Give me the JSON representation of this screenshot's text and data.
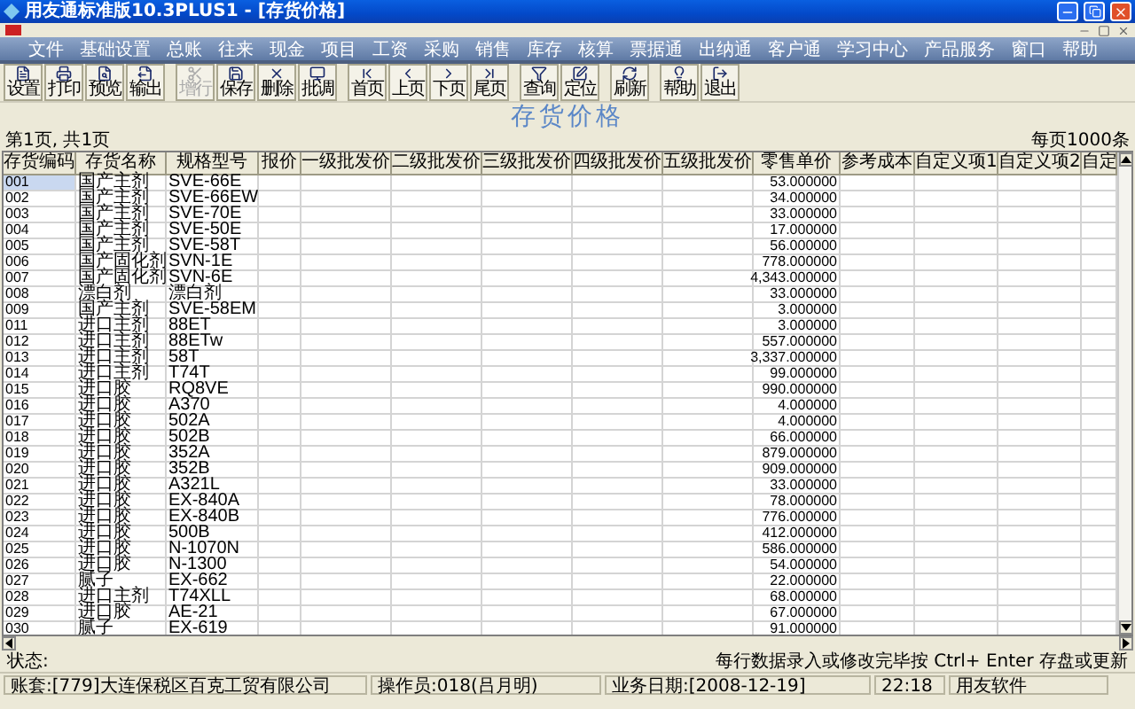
{
  "window": {
    "title": "用友通标准版10.3PLUS1 - [存货价格]"
  },
  "menu": [
    "文件",
    "基础设置",
    "总账",
    "往来",
    "现金",
    "项目",
    "工资",
    "采购",
    "销售",
    "库存",
    "核算",
    "票据通",
    "出纳通",
    "客户通",
    "学习中心",
    "产品服务",
    "窗口",
    "帮助"
  ],
  "toolbar": [
    [
      {
        "label": "设置",
        "disabled": false
      },
      {
        "label": "打印",
        "disabled": false
      },
      {
        "label": "预览",
        "disabled": false
      },
      {
        "label": "输出",
        "disabled": false
      }
    ],
    [
      {
        "label": "增行",
        "disabled": true
      },
      {
        "label": "保存",
        "disabled": false
      },
      {
        "label": "删除",
        "disabled": false
      },
      {
        "label": "批调",
        "disabled": false
      }
    ],
    [
      {
        "label": "首页",
        "disabled": false
      },
      {
        "label": "上页",
        "disabled": false
      },
      {
        "label": "下页",
        "disabled": false
      },
      {
        "label": "尾页",
        "disabled": false
      }
    ],
    [
      {
        "label": "查询",
        "disabled": false
      },
      {
        "label": "定位",
        "disabled": false
      }
    ],
    [
      {
        "label": "刷新",
        "disabled": false
      }
    ],
    [
      {
        "label": "帮助",
        "disabled": false
      },
      {
        "label": "退出",
        "disabled": false
      }
    ]
  ],
  "page": {
    "title": "存货价格",
    "page_info": "第1页, 共1页",
    "page_size": "每页1000条"
  },
  "table": {
    "columns": [
      "存货编码",
      "存货名称",
      "规格型号",
      "报价",
      "一级批发价",
      "二级批发价",
      "三级批发价",
      "四级批发价",
      "五级批发价",
      "零售单价",
      "参考成本",
      "自定义项1",
      "自定义项2",
      "自定"
    ],
    "rows": [
      {
        "code": "001",
        "name": "国产主剂",
        "spec": "SVE-66E",
        "retail": "53.000000",
        "selected": true
      },
      {
        "code": "002",
        "name": "国产主剂",
        "spec": "SVE-66EW",
        "retail": "34.000000",
        "selected": false
      },
      {
        "code": "003",
        "name": "国产主剂",
        "spec": "SVE-70E",
        "retail": "33.000000",
        "selected": false
      },
      {
        "code": "004",
        "name": "国产主剂",
        "spec": "SVE-50E",
        "retail": "17.000000",
        "selected": false
      },
      {
        "code": "005",
        "name": "国产主剂",
        "spec": "SVE-58T",
        "retail": "56.000000",
        "selected": false
      },
      {
        "code": "006",
        "name": "国产固化剂",
        "spec": "SVN-1E",
        "retail": "778.000000",
        "selected": false
      },
      {
        "code": "007",
        "name": "国产固化剂",
        "spec": "SVN-6E",
        "retail": "4,343.000000",
        "selected": false
      },
      {
        "code": "008",
        "name": "漂白剂",
        "spec": "漂白剂",
        "retail": "33.000000",
        "selected": false
      },
      {
        "code": "009",
        "name": "国产主剂",
        "spec": "SVE-58EM",
        "retail": "3.000000",
        "selected": false
      },
      {
        "code": "011",
        "name": "进口主剂",
        "spec": "88ET",
        "retail": "3.000000",
        "selected": false
      },
      {
        "code": "012",
        "name": "进口主剂",
        "spec": "88ETw",
        "retail": "557.000000",
        "selected": false
      },
      {
        "code": "013",
        "name": "进口主剂",
        "spec": "58T",
        "retail": "3,337.000000",
        "selected": false
      },
      {
        "code": "014",
        "name": "进口主剂",
        "spec": "T74T",
        "retail": "99.000000",
        "selected": false
      },
      {
        "code": "015",
        "name": "进口胶",
        "spec": "RQ8VE",
        "retail": "990.000000",
        "selected": false
      },
      {
        "code": "016",
        "name": "进口胶",
        "spec": "A370",
        "retail": "4.000000",
        "selected": false
      },
      {
        "code": "017",
        "name": "进口胶",
        "spec": "502A",
        "retail": "4.000000",
        "selected": false
      },
      {
        "code": "018",
        "name": "进口胶",
        "spec": "502B",
        "retail": "66.000000",
        "selected": false
      },
      {
        "code": "019",
        "name": "进口胶",
        "spec": "352A",
        "retail": "879.000000",
        "selected": false
      },
      {
        "code": "020",
        "name": "进口胶",
        "spec": "352B",
        "retail": "909.000000",
        "selected": false
      },
      {
        "code": "021",
        "name": "进口胶",
        "spec": "A321L",
        "retail": "33.000000",
        "selected": false
      },
      {
        "code": "022",
        "name": "进口胶",
        "spec": "EX-840A",
        "retail": "78.000000",
        "selected": false
      },
      {
        "code": "023",
        "name": "进口胶",
        "spec": "EX-840B",
        "retail": "776.000000",
        "selected": false
      },
      {
        "code": "024",
        "name": "进口胶",
        "spec": "500B",
        "retail": "412.000000",
        "selected": false
      },
      {
        "code": "025",
        "name": "进口胶",
        "spec": "N-1070N",
        "retail": "586.000000",
        "selected": false
      },
      {
        "code": "026",
        "name": "进口胶",
        "spec": "N-1300",
        "retail": "54.000000",
        "selected": false
      },
      {
        "code": "027",
        "name": "腻子",
        "spec": "EX-662",
        "retail": "22.000000",
        "selected": false
      },
      {
        "code": "028",
        "name": "进口主剂",
        "spec": "T74XLL",
        "retail": "68.000000",
        "selected": false
      },
      {
        "code": "029",
        "name": "进口胶",
        "spec": "AE-21",
        "retail": "67.000000",
        "selected": false
      },
      {
        "code": "030",
        "name": "腻子",
        "spec": "EX-619",
        "retail": "91.000000",
        "selected": false
      }
    ]
  },
  "status": {
    "label": "状态:",
    "hint": "每行数据录入或修改完毕按 Ctrl+ Enter 存盘或更新"
  },
  "status_bar": [
    "账套:[779]大连保税区百克工贸有限公司",
    "操作员:018(吕月明)",
    "业务日期:[2008-12-19]",
    "22:18",
    "用友软件"
  ]
}
